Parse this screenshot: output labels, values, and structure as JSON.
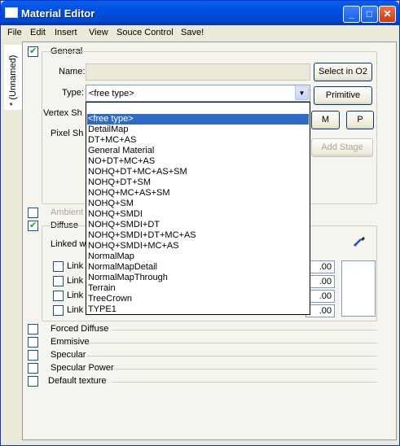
{
  "window": {
    "title": "Material Editor",
    "minimize": "_",
    "maximize": "□",
    "close": "✕"
  },
  "menu": [
    "File",
    "Edit",
    "Insert",
    "View",
    "Souce Control",
    "Save!"
  ],
  "side_tab": "* (Unnamed)",
  "general": {
    "header": "General",
    "name_label": "Name:",
    "name_value": "",
    "type_label": "Type:",
    "type_value": "<free type>",
    "vertex_label": "Vertex Sh",
    "pixel_label": "Pixel Sh",
    "select_button": "Select in O2",
    "primitive_button": "Primitive",
    "m_button": "M",
    "p_button": "P",
    "add_stage_button": "Add Stage"
  },
  "type_options": [
    "<free type>",
    "DetailMap",
    "DT+MC+AS",
    "General Material",
    "NO+DT+MC+AS",
    "NOHQ+DT+MC+AS+SM",
    "NOHQ+DT+SM",
    "NOHQ+MC+AS+SM",
    "NOHQ+SM",
    "NOHQ+SMDI",
    "NOHQ+SMDI+DT",
    "NOHQ+SMDI+DT+MC+AS",
    "NOHQ+SMDI+MC+AS",
    "NormalMap",
    "NormalMapDetail",
    "NormalMapThrough",
    "Terrain",
    "TreeCrown",
    "TYPE1"
  ],
  "ambient": {
    "label": "Ambient",
    "checked": false
  },
  "diffuse": {
    "label": "Diffuse",
    "checked": true,
    "linked_label": "Linked wi",
    "links": [
      "Link",
      "Link",
      "Link",
      "Link"
    ],
    "values": [
      ".00",
      ".00",
      ".00",
      ".00"
    ]
  },
  "sections": [
    {
      "label": "Forced Diffuse",
      "checked": false
    },
    {
      "label": "Emmisive",
      "checked": false
    },
    {
      "label": "Specular",
      "checked": false
    },
    {
      "label": "Specular Power",
      "checked": false
    },
    {
      "label": "Default texture",
      "checked": false
    }
  ]
}
